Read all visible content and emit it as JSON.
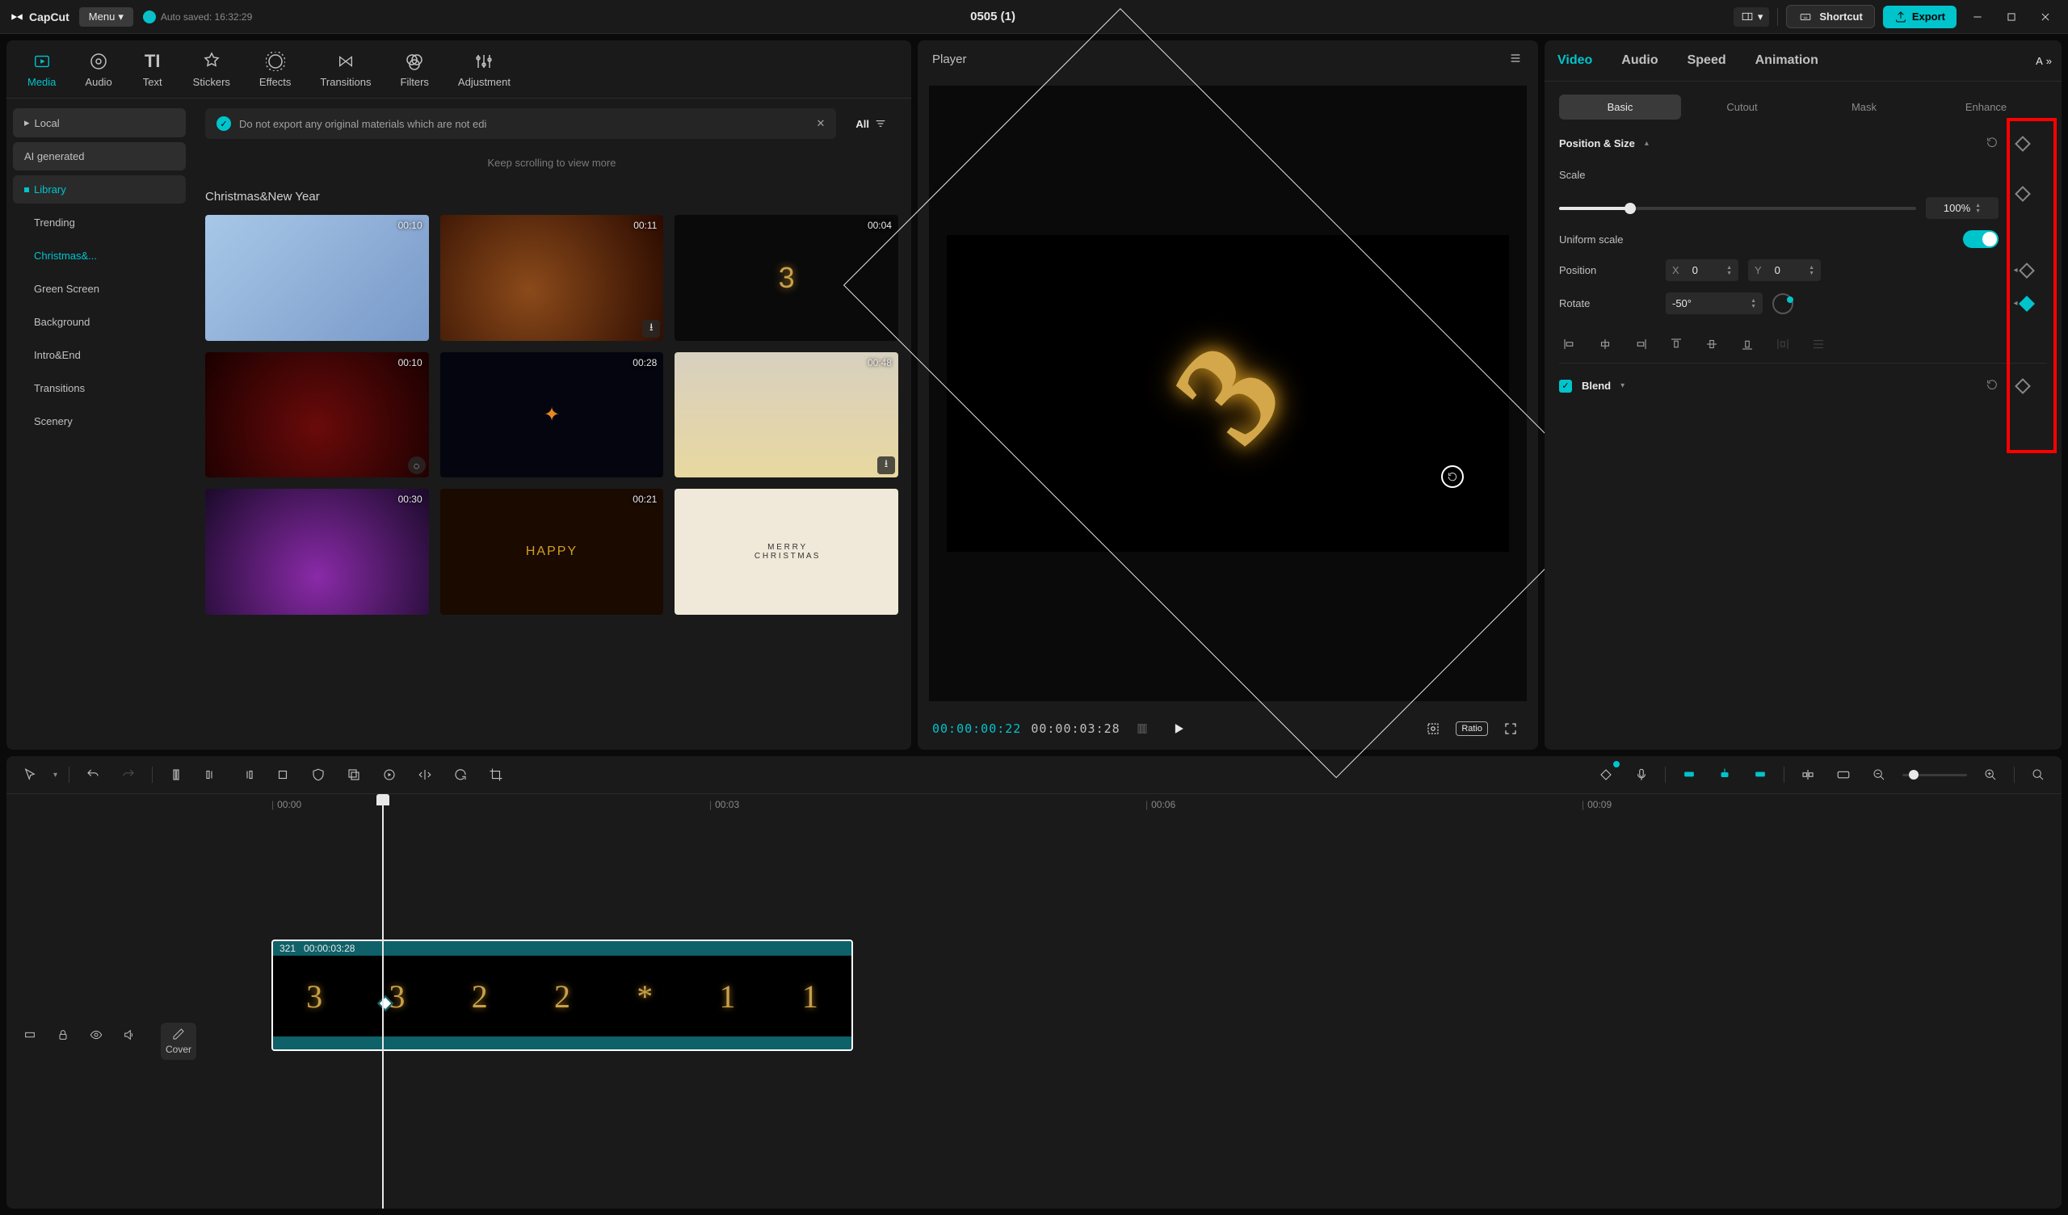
{
  "titlebar": {
    "app_name": "CapCut",
    "menu_label": "Menu",
    "autosave_label": "Auto saved: 16:32:29",
    "project_title": "0505 (1)",
    "shortcut_label": "Shortcut",
    "export_label": "Export"
  },
  "media_tabs": [
    "Media",
    "Audio",
    "Text",
    "Stickers",
    "Effects",
    "Transitions",
    "Filters",
    "Adjustment"
  ],
  "media_side": {
    "local": "Local",
    "ai": "AI generated",
    "library": "Library",
    "items": [
      "Trending",
      "Christmas&...",
      "Green Screen",
      "Background",
      "Intro&End",
      "Transitions",
      "Scenery"
    ]
  },
  "media_grid": {
    "hint": "Keep scrolling to view more",
    "notice": "Do not export any original materials which are not edi",
    "all_label": "All",
    "section": "Christmas&New Year",
    "thumbs": [
      {
        "dur": "00:10"
      },
      {
        "dur": "00:11"
      },
      {
        "dur": "00:04"
      },
      {
        "dur": "00:10"
      },
      {
        "dur": "00:28"
      },
      {
        "dur": "00:48"
      },
      {
        "dur": "00:30"
      },
      {
        "dur": "00:21"
      },
      {
        "dur": ""
      }
    ]
  },
  "player": {
    "title": "Player",
    "cur_time": "00:00:00:22",
    "dur_time": "00:00:03:28",
    "ratio_label": "Ratio"
  },
  "inspector": {
    "tabs": [
      "Video",
      "Audio",
      "Speed",
      "Animation",
      "A"
    ],
    "sub_tabs": [
      "Basic",
      "Cutout",
      "Mask",
      "Enhance"
    ],
    "position_size": "Position & Size",
    "scale_label": "Scale",
    "scale_value": "100%",
    "uniform_label": "Uniform scale",
    "position_label": "Position",
    "pos_x_label": "X",
    "pos_x": "0",
    "pos_y_label": "Y",
    "pos_y": "0",
    "rotate_label": "Rotate",
    "rotate_value": "-50°",
    "blend_label": "Blend"
  },
  "timeline": {
    "ticks": [
      "00:00",
      "00:03",
      "00:06",
      "00:09"
    ],
    "clip": {
      "name": "321",
      "dur": "00:00:03:28"
    },
    "cover_label": "Cover",
    "frames": [
      "3",
      "3",
      "2",
      "2",
      "*",
      "1",
      "1"
    ]
  }
}
